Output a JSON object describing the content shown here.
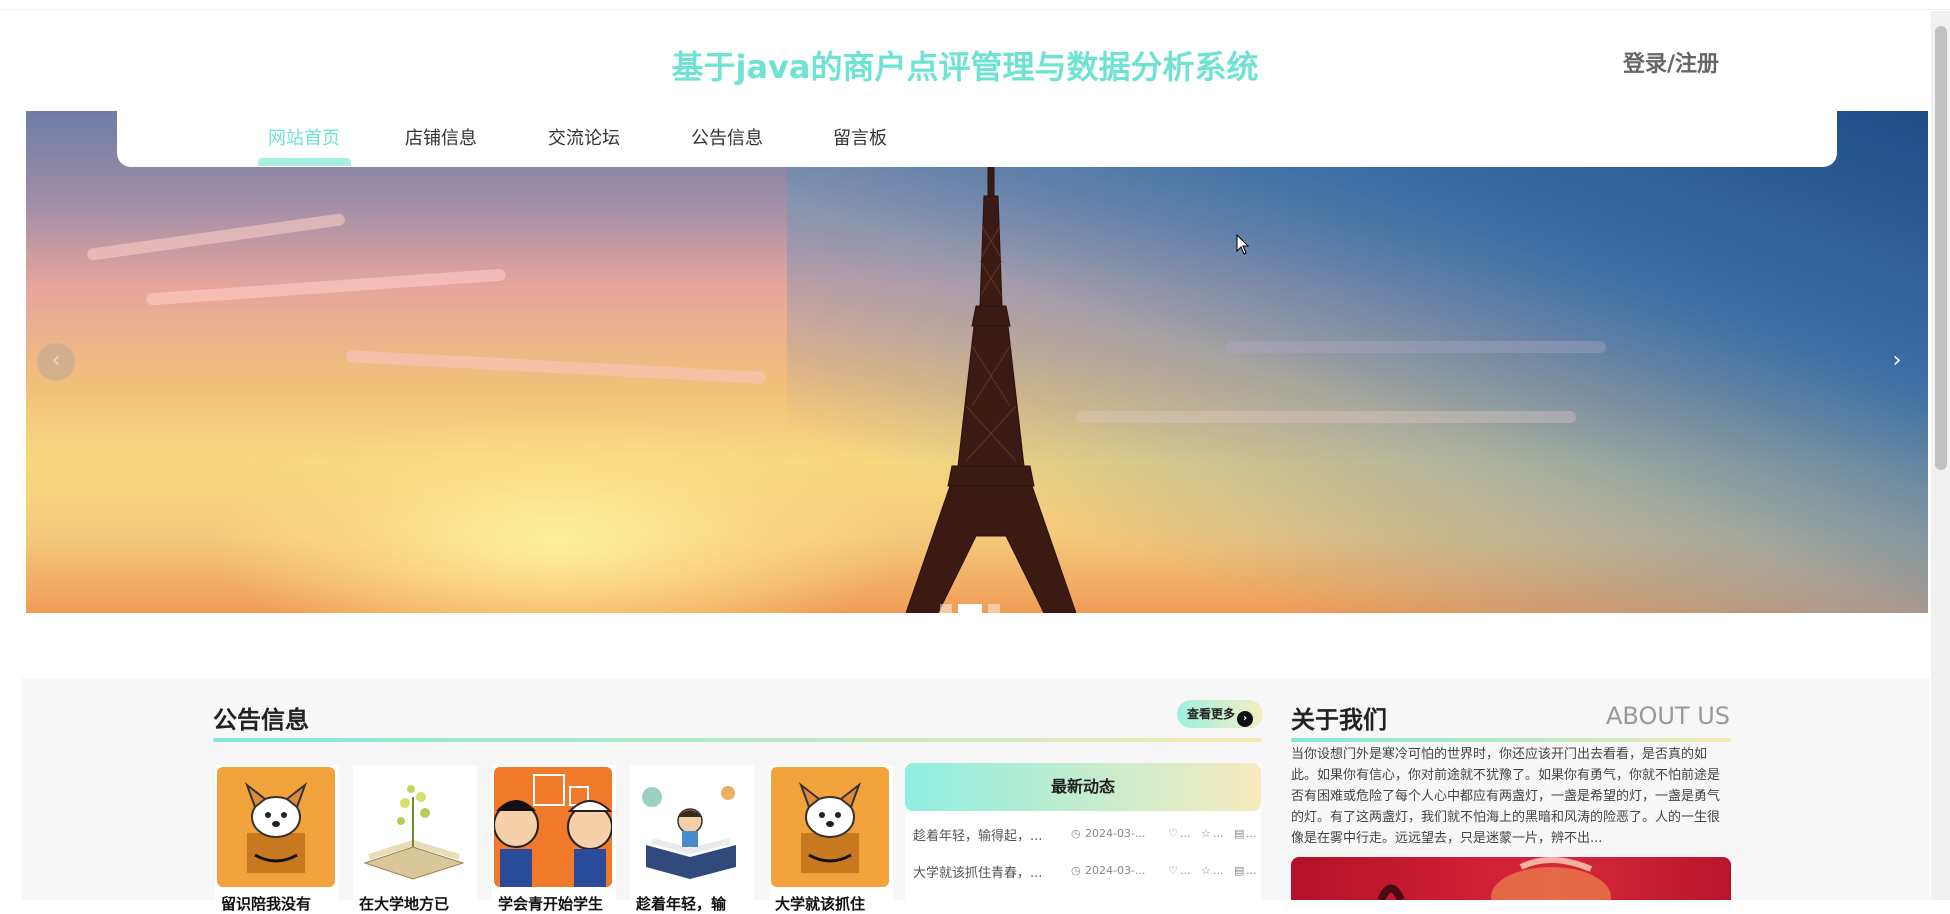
{
  "header": {
    "site_title": "基于java的商户点评管理与数据分析系统",
    "login_label": "登录/注册"
  },
  "nav": {
    "items": [
      {
        "label": "网站首页",
        "active": true
      },
      {
        "label": "店铺信息",
        "active": false
      },
      {
        "label": "交流论坛",
        "active": false
      },
      {
        "label": "公告信息",
        "active": false
      },
      {
        "label": "留言板",
        "active": false
      }
    ]
  },
  "banner": {
    "prev_label": "‹",
    "next_label": "›",
    "slide_count": 3,
    "active_slide": 2
  },
  "notice": {
    "title": "公告信息",
    "more_label": "查看更多",
    "cards": [
      {
        "caption": "留识陪我没有",
        "image": "box-dog-icon"
      },
      {
        "caption": "在大学地方已",
        "image": "book-plant-icon"
      },
      {
        "caption": "学会青开始学生",
        "image": "cartoon-boy-icon"
      },
      {
        "caption": "趁着年轻，输",
        "image": "reading-boy-icon"
      },
      {
        "caption": "大学就该抓住",
        "image": "box-dog-icon"
      }
    ]
  },
  "news": {
    "title": "最新动态",
    "rows": [
      {
        "text": "趁着年轻，输得起，...",
        "date": "2024-03-...",
        "likes": "...",
        "favs": "...",
        "comments": "..."
      },
      {
        "text": "大学就该抓住青春，...",
        "date": "2024-03-...",
        "likes": "...",
        "favs": "...",
        "comments": "..."
      }
    ]
  },
  "about": {
    "title": "关于我们",
    "subtitle": "ABOUT US",
    "text": "当你设想门外是寒冷可怕的世界时，你还应该开门出去看看，是否真的如此。如果你有信心，你对前途就不犹豫了。如果你有勇气，你就不怕前途是否有困难或危险了每个人心中都应有两盏灯，一盏是希望的灯，一盏是勇气的灯。有了这两盏灯，我们就不怕海上的黑暗和风涛的险恶了。人的一生很像是在雾中行走。远远望去，只是迷蒙一片，辨不出..."
  },
  "colors": {
    "accent": "#6fe3d2",
    "gradient_end": "#f5e9b8"
  }
}
